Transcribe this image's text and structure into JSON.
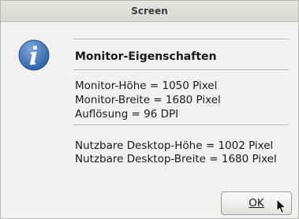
{
  "window": {
    "title": "Screen"
  },
  "dialog": {
    "icon": "info-icon",
    "heading": "Monitor-Eigenschaften",
    "lines": [
      "Monitor-Höhe = 1050 Pixel",
      "Monitor-Breite = 1680 Pixel",
      "Auflösung = 96 DPI",
      "Nutzbare Desktop-Höhe = 1002 Pixel",
      "Nutzbare Desktop-Breite = 1680 Pixel"
    ],
    "ok_label": "OK"
  },
  "colors": {
    "icon_blue": "#3b6fb5",
    "background": "#f2f1f0"
  }
}
